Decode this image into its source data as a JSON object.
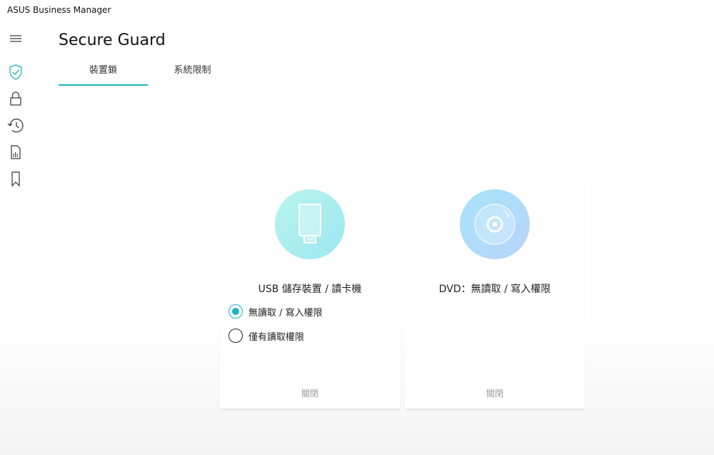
{
  "app": {
    "title": "ASUS Business Manager"
  },
  "page": {
    "title": "Secure Guard"
  },
  "tabs": [
    {
      "label": "裝置鎖",
      "active": true
    },
    {
      "label": "系統限制",
      "active": false
    }
  ],
  "sidebar": {
    "items": [
      {
        "icon": "menu-icon"
      },
      {
        "icon": "shield-check-icon"
      },
      {
        "icon": "lock-icon"
      },
      {
        "icon": "history-icon"
      },
      {
        "icon": "document-icon"
      },
      {
        "icon": "bookmark-icon"
      }
    ]
  },
  "cards": [
    {
      "icon": "usb-drive-icon",
      "title": "USB 儲存裝置 / 讀卡機",
      "options": [
        {
          "label": "無讀取 / 寫入權限",
          "checked": true
        },
        {
          "label": "僅有讀取權限",
          "checked": false
        }
      ],
      "close_label": "關閉"
    },
    {
      "icon": "disc-icon",
      "title": "DVD：無讀取 / 寫入權限",
      "close_label": "關閉"
    }
  ],
  "colors": {
    "accent": "#1fb4c3",
    "usb_circle_start": "#b8f5ec",
    "usb_circle_end": "#9de6f2",
    "dvd_circle_start": "#a6e4f8",
    "dvd_circle_end": "#b9d4fb"
  }
}
